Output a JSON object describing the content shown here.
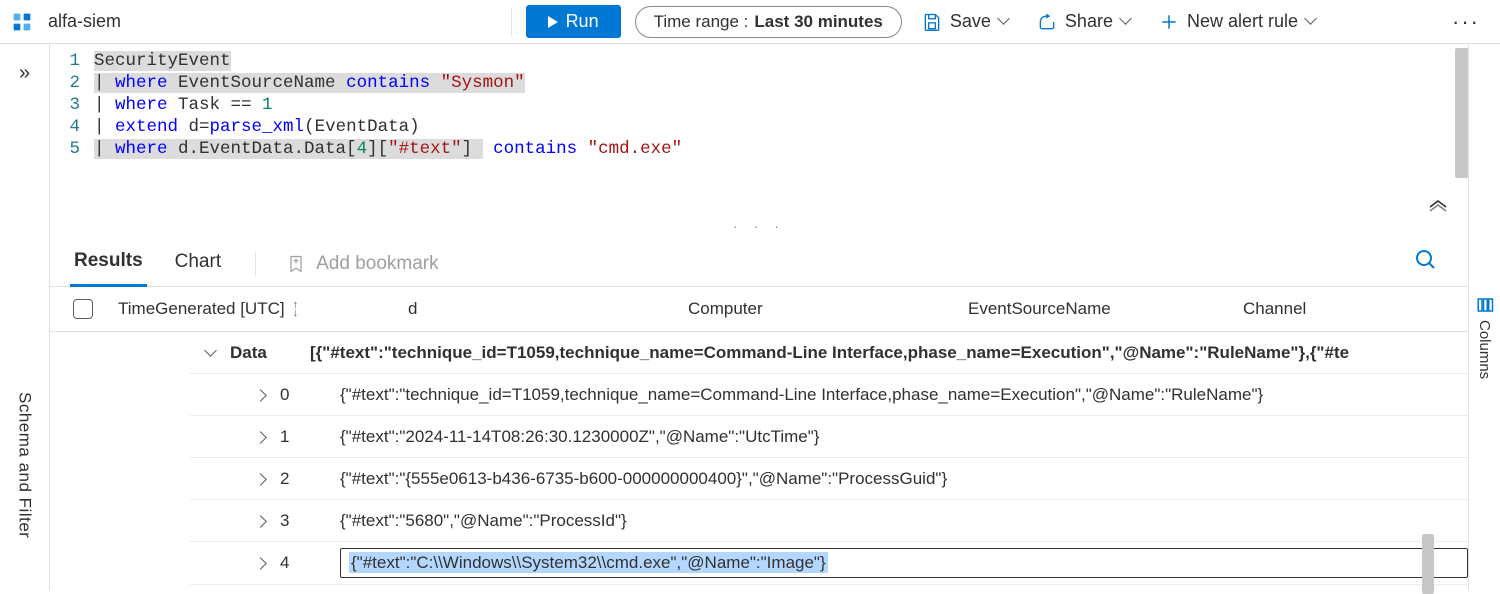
{
  "header": {
    "workspace": "alfa-siem",
    "run_label": "Run",
    "time_range_prefix": "Time range :",
    "time_range_value": "Last 30 minutes",
    "save_label": "Save",
    "share_label": "Share",
    "new_alert_label": "New alert rule"
  },
  "left_rail": {
    "label": "Schema and Filter"
  },
  "right_rail": {
    "label": "Columns"
  },
  "query": {
    "lines": [
      {
        "n": "1",
        "segments": [
          {
            "t": "SecurityEvent",
            "c": "tok-id hl-sel"
          }
        ]
      },
      {
        "n": "2",
        "segments": [
          {
            "t": "| ",
            "c": "tok-pipe hl-sel"
          },
          {
            "t": "where",
            "c": "tok-kw hl-sel"
          },
          {
            "t": " EventSourceName ",
            "c": "tok-id hl-sel"
          },
          {
            "t": "contains",
            "c": "tok-kw hl-sel"
          },
          {
            "t": " ",
            "c": "hl-sel"
          },
          {
            "t": "\"Sysmon\"",
            "c": "tok-str hl-sel"
          }
        ]
      },
      {
        "n": "3",
        "segments": [
          {
            "t": "| ",
            "c": "tok-pipe"
          },
          {
            "t": "where",
            "c": "tok-kw"
          },
          {
            "t": " Task == ",
            "c": "tok-id"
          },
          {
            "t": "1",
            "c": "tok-num"
          }
        ]
      },
      {
        "n": "4",
        "segments": [
          {
            "t": "| ",
            "c": "tok-pipe"
          },
          {
            "t": "extend",
            "c": "tok-kw"
          },
          {
            "t": " d=",
            "c": "tok-id"
          },
          {
            "t": "parse_xml",
            "c": "tok-fn"
          },
          {
            "t": "(EventData)",
            "c": "tok-id"
          }
        ]
      },
      {
        "n": "5",
        "segments": [
          {
            "t": "| ",
            "c": "tok-pipe hl-sel"
          },
          {
            "t": "where",
            "c": "tok-kw hl-sel"
          },
          {
            "t": " d.EventData.Data[",
            "c": "tok-id hl-sel"
          },
          {
            "t": "4",
            "c": "tok-num hl-sel"
          },
          {
            "t": "][",
            "c": "tok-id hl-sel"
          },
          {
            "t": "\"#text\"",
            "c": "tok-str hl-sel"
          },
          {
            "t": "] ",
            "c": "tok-id hl-sel"
          },
          {
            "t": " ",
            "c": ""
          },
          {
            "t": "contains",
            "c": "tok-kw"
          },
          {
            "t": " ",
            "c": ""
          },
          {
            "t": "\"cmd.exe\"",
            "c": "tok-str"
          }
        ]
      }
    ]
  },
  "tabs": {
    "results": "Results",
    "chart": "Chart",
    "add_bookmark": "Add bookmark"
  },
  "columns": {
    "time": "TimeGenerated [UTC]",
    "d": "d",
    "computer": "Computer",
    "esn": "EventSourceName",
    "channel": "Channel"
  },
  "rows": {
    "parent_key": "Data",
    "parent_val": "[{\"#text\":\"technique_id=T1059,technique_name=Command-Line Interface,phase_name=Execution\",\"@Name\":\"RuleName\"},{\"#te",
    "items": [
      {
        "idx": "0",
        "val": "{\"#text\":\"technique_id=T1059,technique_name=Command-Line Interface,phase_name=Execution\",\"@Name\":\"RuleName\"}"
      },
      {
        "idx": "1",
        "val": "{\"#text\":\"2024-11-14T08:26:30.1230000Z\",\"@Name\":\"UtcTime\"}"
      },
      {
        "idx": "2",
        "val": "{\"#text\":\"{555e0613-b436-6735-b600-000000000400}\",\"@Name\":\"ProcessGuid\"}"
      },
      {
        "idx": "3",
        "val": "{\"#text\":\"5680\",\"@Name\":\"ProcessId\"}"
      },
      {
        "idx": "4",
        "val": "{\"#text\":\"C:\\\\Windows\\\\System32\\\\cmd.exe\",\"@Name\":\"Image\"}",
        "hl": true
      }
    ]
  }
}
